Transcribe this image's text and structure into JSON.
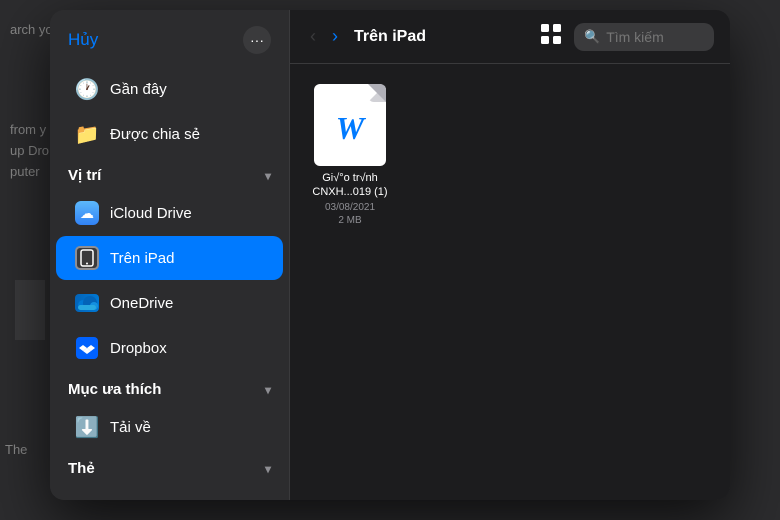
{
  "background": {
    "text_top": "arch yo",
    "text_mid": "from y\nup Dro\nputer",
    "text_bottom": "The"
  },
  "sidebar": {
    "cancel_label": "Hủy",
    "sections": {
      "recent_label": "Gần đây",
      "shared_label": "Được chia sẻ",
      "location_header": "Vị trí",
      "location_chevron": "▾",
      "locations": [
        {
          "id": "icloud",
          "label": "iCloud Drive",
          "icon": "icloud"
        },
        {
          "id": "ipad",
          "label": "Trên iPad",
          "icon": "ipad",
          "active": true
        },
        {
          "id": "onedrive",
          "label": "OneDrive",
          "icon": "onedrive"
        },
        {
          "id": "dropbox",
          "label": "Dropbox",
          "icon": "dropbox"
        }
      ],
      "favorites_header": "Mục ưa thích",
      "favorites_chevron": "▾",
      "favorites": [
        {
          "id": "download",
          "label": "Tải về",
          "icon": "download"
        }
      ],
      "tags_header": "Thẻ",
      "tags_chevron": "▾"
    }
  },
  "main": {
    "nav_back_disabled": true,
    "nav_forward_disabled": false,
    "breadcrumb": "Trên iPad",
    "search_placeholder": "Tìm kiếm",
    "files": [
      {
        "name": "Gi√°o tr√nh\nCNXH...019 (1)",
        "date": "03/08/2021",
        "size": "2 MB",
        "type": "docx",
        "letter": "W"
      }
    ]
  }
}
